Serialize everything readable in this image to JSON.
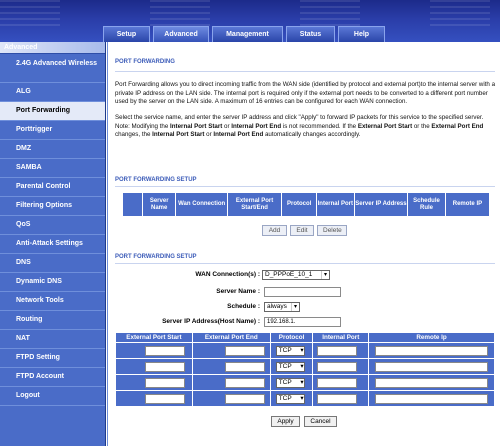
{
  "nav": {
    "tabs": [
      "Setup",
      "Advanced",
      "Management",
      "Status",
      "Help"
    ]
  },
  "sidebar": {
    "heading": "Advanced",
    "items": [
      "2.4G Advanced Wireless",
      "ALG",
      "Port Forwarding",
      "Porttrigger",
      "DMZ",
      "SAMBA",
      "Parental Control",
      "Filtering Options",
      "QoS",
      "Anti-Attack Settings",
      "DNS",
      "Dynamic DNS",
      "Network Tools",
      "Routing",
      "NAT",
      "FTPD Setting",
      "FTPD Account",
      "Logout"
    ]
  },
  "main": {
    "title": "PORT FORWARDING",
    "desc1": "Port Forwarding allows you to direct incoming traffic from the WAN side (identified by protocol and external port)to the internal server with a private IP address on the LAN side. The internal port is required only if the external port needs to be converted to a different port number used by the server on the LAN side. A maximum of 16 entries can be configured for each WAN connection.",
    "desc2_a": "Select the service name, and enter the server IP address and click \"Apply\" to forward IP packets for this service to the specified server. Note: Modifying the ",
    "desc2_b": "Internal Port Start",
    "desc2_c": " or ",
    "desc2_d": "Internal Port End",
    "desc2_e": " is not recommended. If the ",
    "desc2_f": "External Port Start",
    "desc2_g": " or the ",
    "desc2_h": "External Port End",
    "desc2_i": " changes, the ",
    "desc2_j": "Internal Port Start",
    "desc2_k": " or ",
    "desc2_l": "Internal Port End",
    "desc2_m": " automatically changes accordingly.",
    "setup_title_1": "PORT FORWARDING SETUP",
    "table_headers": [
      "",
      "Server Name",
      "Wan Connection",
      "External Port Start/End",
      "Protocol",
      "Internal Port",
      "Server IP Address",
      "Schedule Rule",
      "Remote IP"
    ],
    "buttons": {
      "add": "Add",
      "edit": "Edit",
      "delete": "Delete"
    },
    "setup_title_2": "PORT FORWARDING SETUP",
    "form": {
      "wan_label": "WAN Connection(s) :",
      "wan_value": "D_PPPoE_10_1",
      "server_label": "Server Name :",
      "schedule_label": "Schedule :",
      "schedule_value": "always",
      "ip_label": "Server IP Address(Host Name) :",
      "ip_value": "192.168.1."
    },
    "port_headers": [
      "External Port Start",
      "External Port End",
      "Protocol",
      "Internal Port",
      "Remote Ip"
    ],
    "port_rows": [
      "TCP",
      "TCP",
      "TCP",
      "TCP"
    ],
    "apply": "Apply",
    "cancel": "Cancel"
  }
}
